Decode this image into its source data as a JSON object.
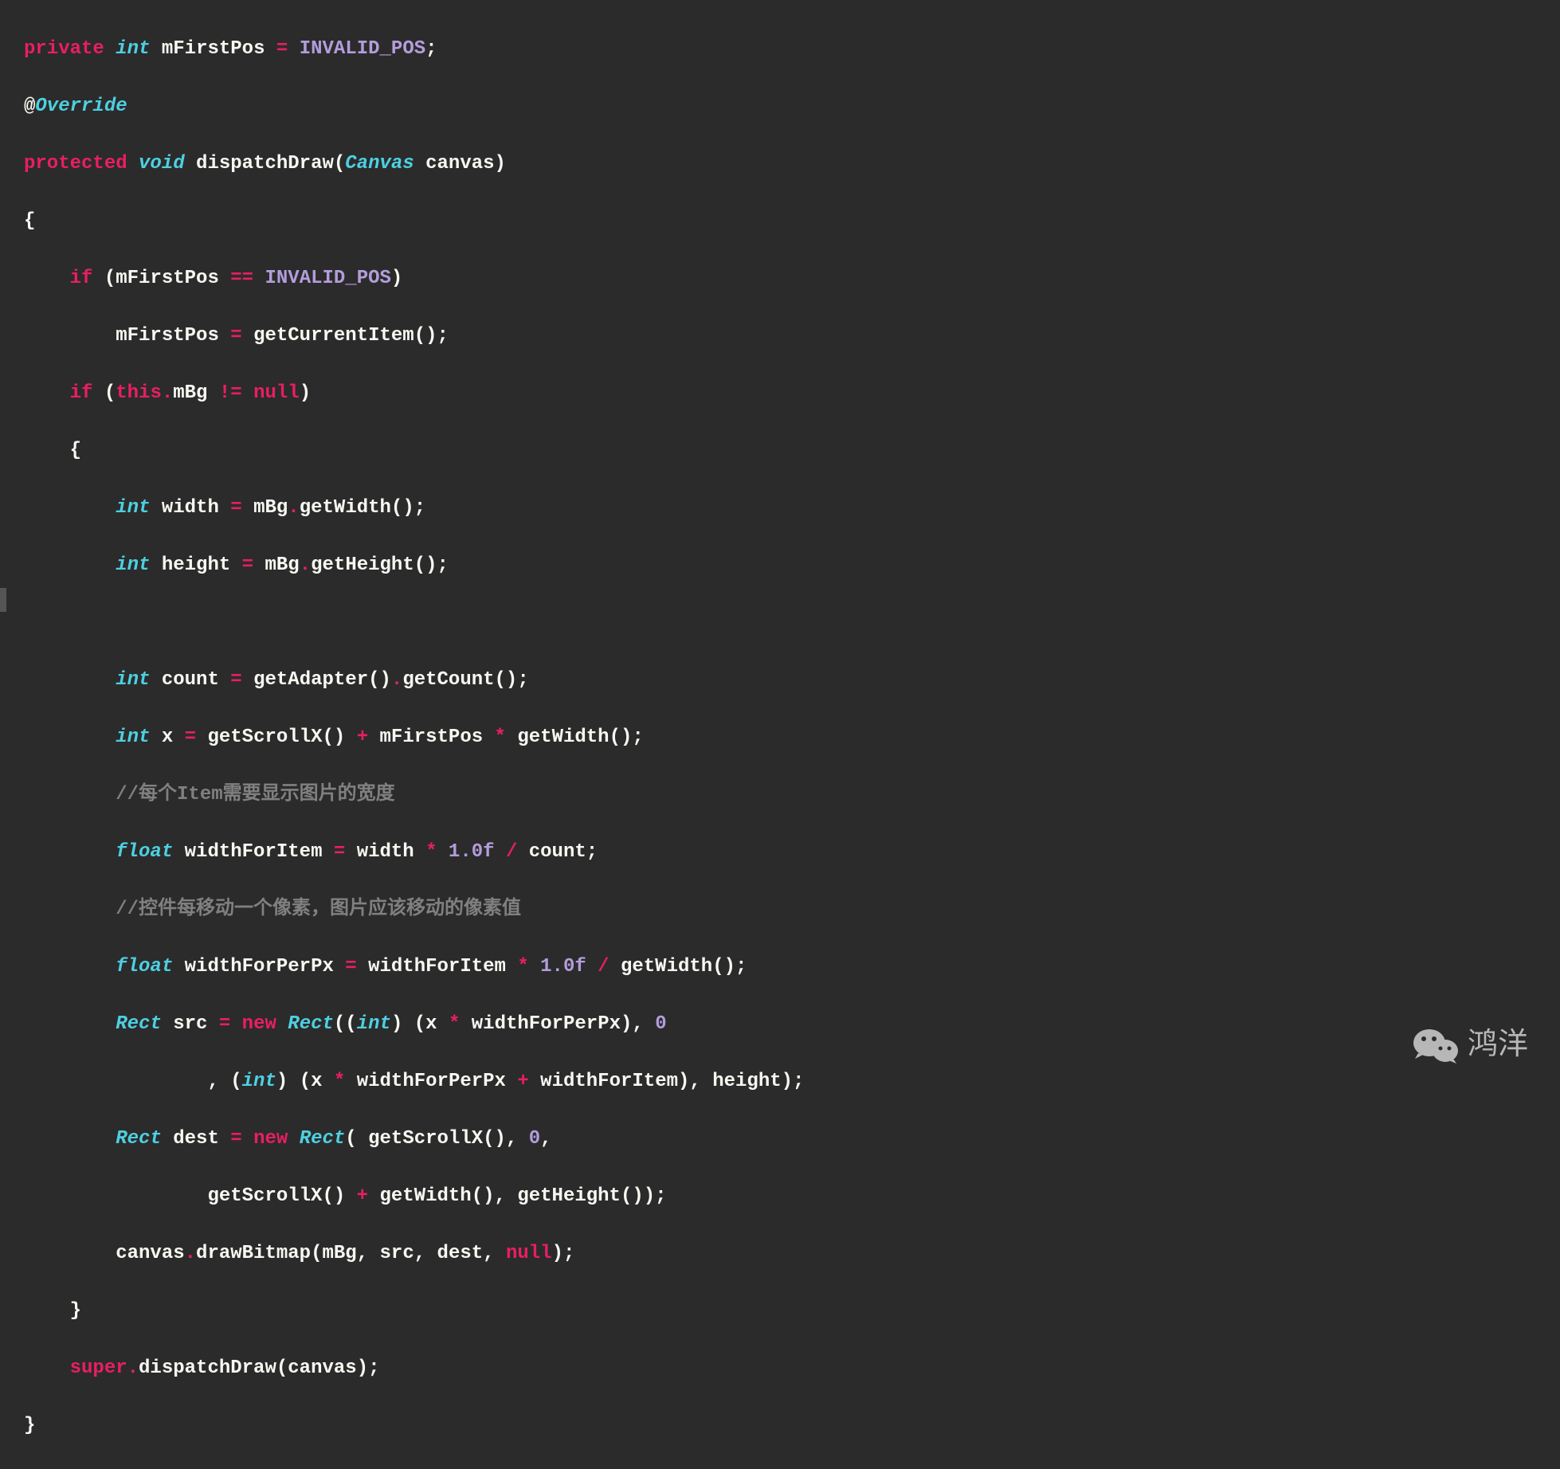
{
  "code": {
    "line1": {
      "kw_private": "private",
      "type_int": "int",
      "var": "mFirstPos",
      "op": "=",
      "const": "INVALID_POS",
      "semi": ";"
    },
    "line2": {
      "at": "@",
      "annotation": "Override"
    },
    "line3": {
      "kw_protected": "protected",
      "type_void": "void",
      "method": "dispatchDraw",
      "paren_open": "(",
      "type_canvas": "Canvas",
      "param": "canvas",
      "paren_close": ")"
    },
    "line4": {
      "brace": "{"
    },
    "line5": {
      "kw_if": "if",
      "paren_open": "(",
      "var": "mFirstPos",
      "op": "==",
      "const": "INVALID_POS",
      "paren_close": ")"
    },
    "line6": {
      "var": "mFirstPos",
      "op": "=",
      "method": "getCurrentItem()",
      "semi": ";"
    },
    "line7": {
      "kw_if": "if",
      "paren_open": "(",
      "kw_this": "this",
      "dot": ".",
      "var": "mBg",
      "op": "!=",
      "kw_null": "null",
      "paren_close": ")"
    },
    "line8": {
      "brace": "{"
    },
    "line9": {
      "type_int": "int",
      "var": "width",
      "op": "=",
      "obj": "mBg",
      "dot": ".",
      "method": "getWidth()",
      "semi": ";"
    },
    "line10": {
      "type_int": "int",
      "var": "height",
      "op": "=",
      "obj": "mBg",
      "dot": ".",
      "method": "getHeight()",
      "semi": ";"
    },
    "line12": {
      "type_int": "int",
      "var": "count",
      "op": "=",
      "method1": "getAdapter()",
      "dot": ".",
      "method2": "getCount()",
      "semi": ";"
    },
    "line13": {
      "type_int": "int",
      "var": "x",
      "op": "=",
      "method1": "getScrollX()",
      "plus": "+",
      "var2": "mFirstPos",
      "mult": "*",
      "method2": "getWidth()",
      "semi": ";"
    },
    "line14": {
      "comment": "//每个Item需要显示图片的宽度"
    },
    "line15": {
      "type_float": "float",
      "var": "widthForItem",
      "op": "=",
      "var2": "width",
      "mult": "*",
      "num": "1.0f",
      "div": "/",
      "var3": "count",
      "semi": ";"
    },
    "line16": {
      "comment": "//控件每移动一个像素，图片应该移动的像素值"
    },
    "line17": {
      "type_float": "float",
      "var": "widthForPerPx",
      "op": "=",
      "var2": "widthForItem",
      "mult": "*",
      "num": "1.0f",
      "div": "/",
      "method": "getWidth()",
      "semi": ";"
    },
    "line18": {
      "type_rect": "Rect",
      "var": "src",
      "op": "=",
      "kw_new": "new",
      "type_rect2": "Rect",
      "paren_open": "((",
      "type_int": "int",
      "paren_close1": ")",
      "paren_open2": "(",
      "var2": "x",
      "mult": "*",
      "var3": "widthForPerPx",
      "paren_close2": "),",
      "num": "0"
    },
    "line19": {
      "comma": ", (",
      "type_int": "int",
      "paren_close": ")",
      "paren_open": "(",
      "var": "x",
      "mult": "*",
      "var2": "widthForPerPx",
      "plus": "+",
      "var3": "widthForItem",
      "paren_close2": "),",
      "var4": "height",
      "paren_close3": ");"
    },
    "line20": {
      "type_rect": "Rect",
      "var": "dest",
      "op": "=",
      "kw_new": "new",
      "type_rect2": "Rect",
      "paren_open": "(",
      "method": "getScrollX()",
      "comma": ",",
      "num": "0",
      "comma2": ","
    },
    "line21": {
      "method1": "getScrollX()",
      "plus": "+",
      "method2": "getWidth()",
      "comma": ",",
      "method3": "getHeight()",
      "paren_close": ");"
    },
    "line22": {
      "var": "canvas",
      "dot": ".",
      "method": "drawBitmap",
      "paren_open": "(",
      "arg1": "mBg",
      "comma1": ",",
      "arg2": "src",
      "comma2": ",",
      "arg3": "dest",
      "comma3": ",",
      "kw_null": "null",
      "paren_close": ");"
    },
    "line23": {
      "brace": "}"
    },
    "line24": {
      "kw_super": "super",
      "dot": ".",
      "method": "dispatchDraw",
      "paren_open": "(",
      "arg": "canvas",
      "paren_close": ");"
    },
    "line25": {
      "brace": "}"
    }
  },
  "watermark": {
    "text": "鸿洋"
  }
}
